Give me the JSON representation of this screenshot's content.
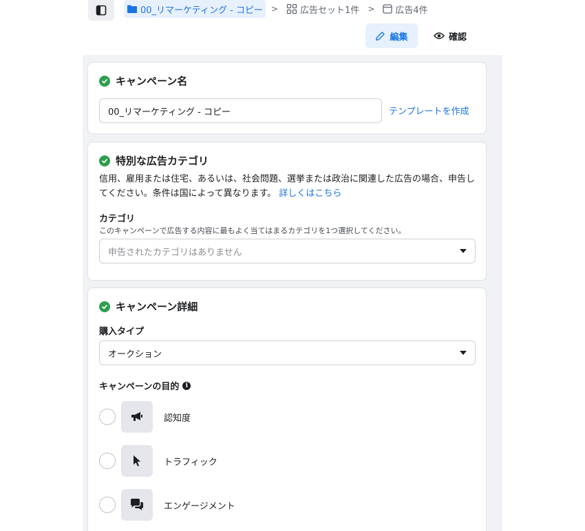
{
  "breadcrumb": {
    "campaign": "00_リマーケティング - コピー",
    "adset": "広告セット1件",
    "ad": "広告4件"
  },
  "header_actions": {
    "edit_label": "編集",
    "review_label": "確認"
  },
  "campaign_name_section": {
    "title": "キャンペーン名",
    "name_value": "00_リマーケティング - コピー",
    "create_template_link": "テンプレートを作成"
  },
  "special_category_section": {
    "title": "特別な広告カテゴリ",
    "description": "信用、雇用または住宅、あるいは、社会問題、選挙または政治に関連した広告の場合、申告してください。条件は国によって異なります。",
    "learn_more_link": "詳しくはこちら",
    "category_label": "カテゴリ",
    "category_help": "このキャンペーンで広告する内容に最もよく当てはまるカテゴリを1つ選択してください。",
    "category_placeholder": "申告されたカテゴリはありません"
  },
  "campaign_details_section": {
    "title": "キャンペーン詳細",
    "buying_type_label": "購入タイプ",
    "buying_type_value": "オークション",
    "objective_label": "キャンペーンの目的",
    "objectives": [
      {
        "label": "認知度",
        "icon": "megaphone-icon",
        "selected": false
      },
      {
        "label": "トラフィック",
        "icon": "cursor-icon",
        "selected": false
      },
      {
        "label": "エンゲージメント",
        "icon": "chat-bubbles-icon",
        "selected": false
      }
    ]
  },
  "colors": {
    "accent": "#1b74e4",
    "success": "#2e9e4f",
    "canvas_bg": "#f0f2f5"
  }
}
